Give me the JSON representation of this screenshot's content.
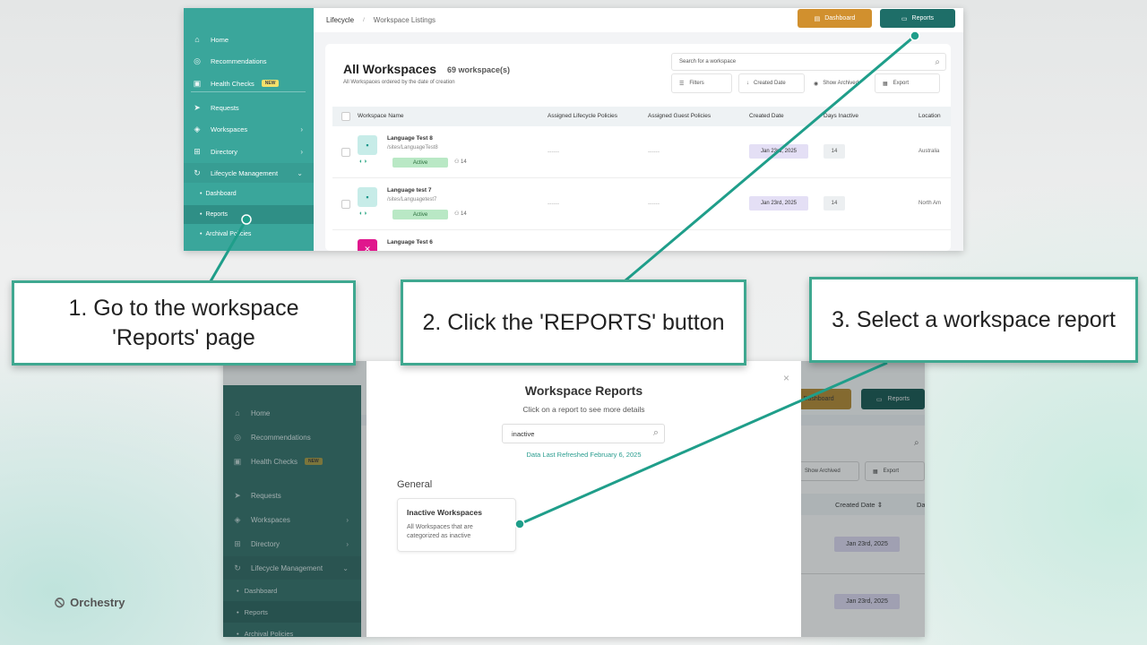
{
  "top_screenshot": {
    "sidebar": {
      "items": [
        {
          "label": "Home",
          "icon": "home-icon",
          "glyph": "⌂"
        },
        {
          "label": "Recommendations",
          "icon": "recommendations-icon",
          "glyph": "◎"
        },
        {
          "label": "Health Checks",
          "icon": "health-icon",
          "glyph": "▣",
          "badge": "NEW"
        },
        {
          "label": "Requests",
          "icon": "send-icon",
          "glyph": "➤"
        },
        {
          "label": "Workspaces",
          "icon": "layers-icon",
          "glyph": "◈",
          "chevron": "›"
        },
        {
          "label": "Directory",
          "icon": "org-chart-icon",
          "glyph": "⊞",
          "chevron": "›"
        },
        {
          "label": "Lifecycle Management",
          "icon": "refresh-icon",
          "glyph": "↻",
          "chevron": "⌄"
        }
      ],
      "subitems": [
        "Dashboard",
        "Reports",
        "Archival Policies"
      ]
    },
    "header": {
      "breadcrumb_1": "Lifecycle",
      "breadcrumb_2": "Workspace Listings",
      "dashboard_button": "Dashboard",
      "reports_button": "Reports"
    },
    "main": {
      "title": "All Workspaces",
      "count": "69 workspace(s)",
      "subtitle": "All Workspaces ordered by the date of creation",
      "search_placeholder": "Search for a workspace",
      "toolbar": {
        "filters": "Filters",
        "created_date": "Created Date",
        "show_archived": "Show Archived",
        "export": "Export"
      },
      "columns": [
        "Workspace Name",
        "Assigned Lifecycle Policies",
        "Assigned Guest Policies",
        "Created Date",
        "Days Inactive",
        "Location"
      ],
      "rows": [
        {
          "name": "Language Test 8",
          "url": "/sites/LanguageTest8",
          "status": "Active",
          "members": "14",
          "lifecycle": "------",
          "guest": "------",
          "created": "Jan 23rd, 2025",
          "days": "14",
          "location": "Australia"
        },
        {
          "name": "Language test 7",
          "url": "/sites/Languagetest7",
          "status": "Active",
          "members": "14",
          "lifecycle": "------",
          "guest": "------",
          "created": "Jan 23rd, 2025",
          "days": "14",
          "location": "North Am"
        },
        {
          "name": "Language Test 6"
        }
      ]
    }
  },
  "callouts": {
    "one": "1. Go to the workspace 'Reports' page",
    "two": "2. Click the 'REPORTS' button",
    "three": "3. Select a workspace report"
  },
  "bottom_screenshot": {
    "sidebar": {
      "items": [
        {
          "label": "Home",
          "glyph": "⌂"
        },
        {
          "label": "Recommendations",
          "glyph": "◎"
        },
        {
          "label": "Health Checks",
          "glyph": "▣",
          "badge": "NEW"
        },
        {
          "label": "Requests",
          "glyph": "➤"
        },
        {
          "label": "Workspaces",
          "glyph": "◈",
          "chevron": "›"
        },
        {
          "label": "Directory",
          "glyph": "⊞",
          "chevron": "›"
        },
        {
          "label": "Lifecycle Management",
          "glyph": "↻",
          "chevron": "⌄"
        }
      ],
      "subitems": [
        "Dashboard",
        "Reports",
        "Archival Policies"
      ]
    },
    "bg": {
      "dashboard": "Dashboard",
      "reports": "Reports",
      "show_archived": "Show Archived",
      "export": "Export",
      "created_date": "Created Date",
      "col_partial": "Da",
      "date1": "Jan 23rd, 2025",
      "date2": "Jan 23rd, 2025"
    },
    "modal": {
      "title": "Workspace Reports",
      "subtitle": "Click on a report to see more details",
      "search_value": "inactive",
      "refreshed": "Data Last Refreshed February 6, 2025",
      "section": "General",
      "report_title": "Inactive Workspaces",
      "report_desc": "All Workspaces that are categorized as inactive"
    }
  },
  "brand": {
    "name": "Orchestry"
  },
  "colors": {
    "teal": "#3aa69b",
    "dark_teal": "#1e6e68",
    "orange": "#d1902e",
    "callout_border": "#3fa890",
    "connector": "#1f9e8a"
  }
}
